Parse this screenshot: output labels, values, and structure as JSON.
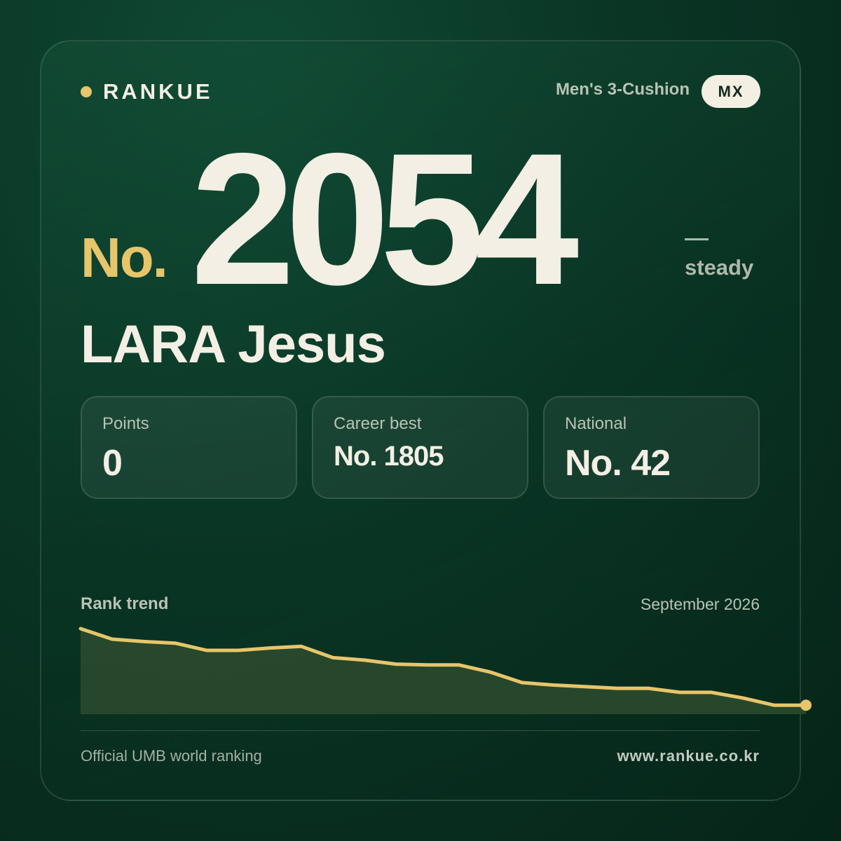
{
  "brand": {
    "name": "RANKUE"
  },
  "header": {
    "category": "Men's 3-Cushion",
    "country": "MX"
  },
  "rank": {
    "prefix": "No.",
    "number": "2054",
    "movement": "steady"
  },
  "player": {
    "name": "LARA Jesus"
  },
  "stats": {
    "points": {
      "label": "Points",
      "value": "0"
    },
    "career_best": {
      "label": "Career best",
      "value": "No. 1805"
    },
    "national": {
      "label": "National",
      "value": "No. 42"
    }
  },
  "trend": {
    "title": "Rank trend",
    "period": "September 2026"
  },
  "footer": {
    "source": "Official UMB world ranking",
    "url": "www.rankue.co.kr"
  },
  "colors": {
    "accent": "#e7c56a",
    "text": "#f3efe4",
    "muted": "#b9c3b6",
    "background": "#0a3525"
  },
  "chart_data": {
    "type": "area",
    "title": "Rank trend",
    "xlabel": "",
    "ylabel": "",
    "y_direction": "higher point = better rank",
    "values": [
      1,
      0.87,
      0.84,
      0.82,
      0.73,
      0.73,
      0.76,
      0.78,
      0.64,
      0.61,
      0.56,
      0.55,
      0.55,
      0.46,
      0.33,
      0.3,
      0.28,
      0.26,
      0.26,
      0.21,
      0.21,
      0.14,
      0.05,
      0.05
    ],
    "grid": false,
    "legend": "none"
  }
}
